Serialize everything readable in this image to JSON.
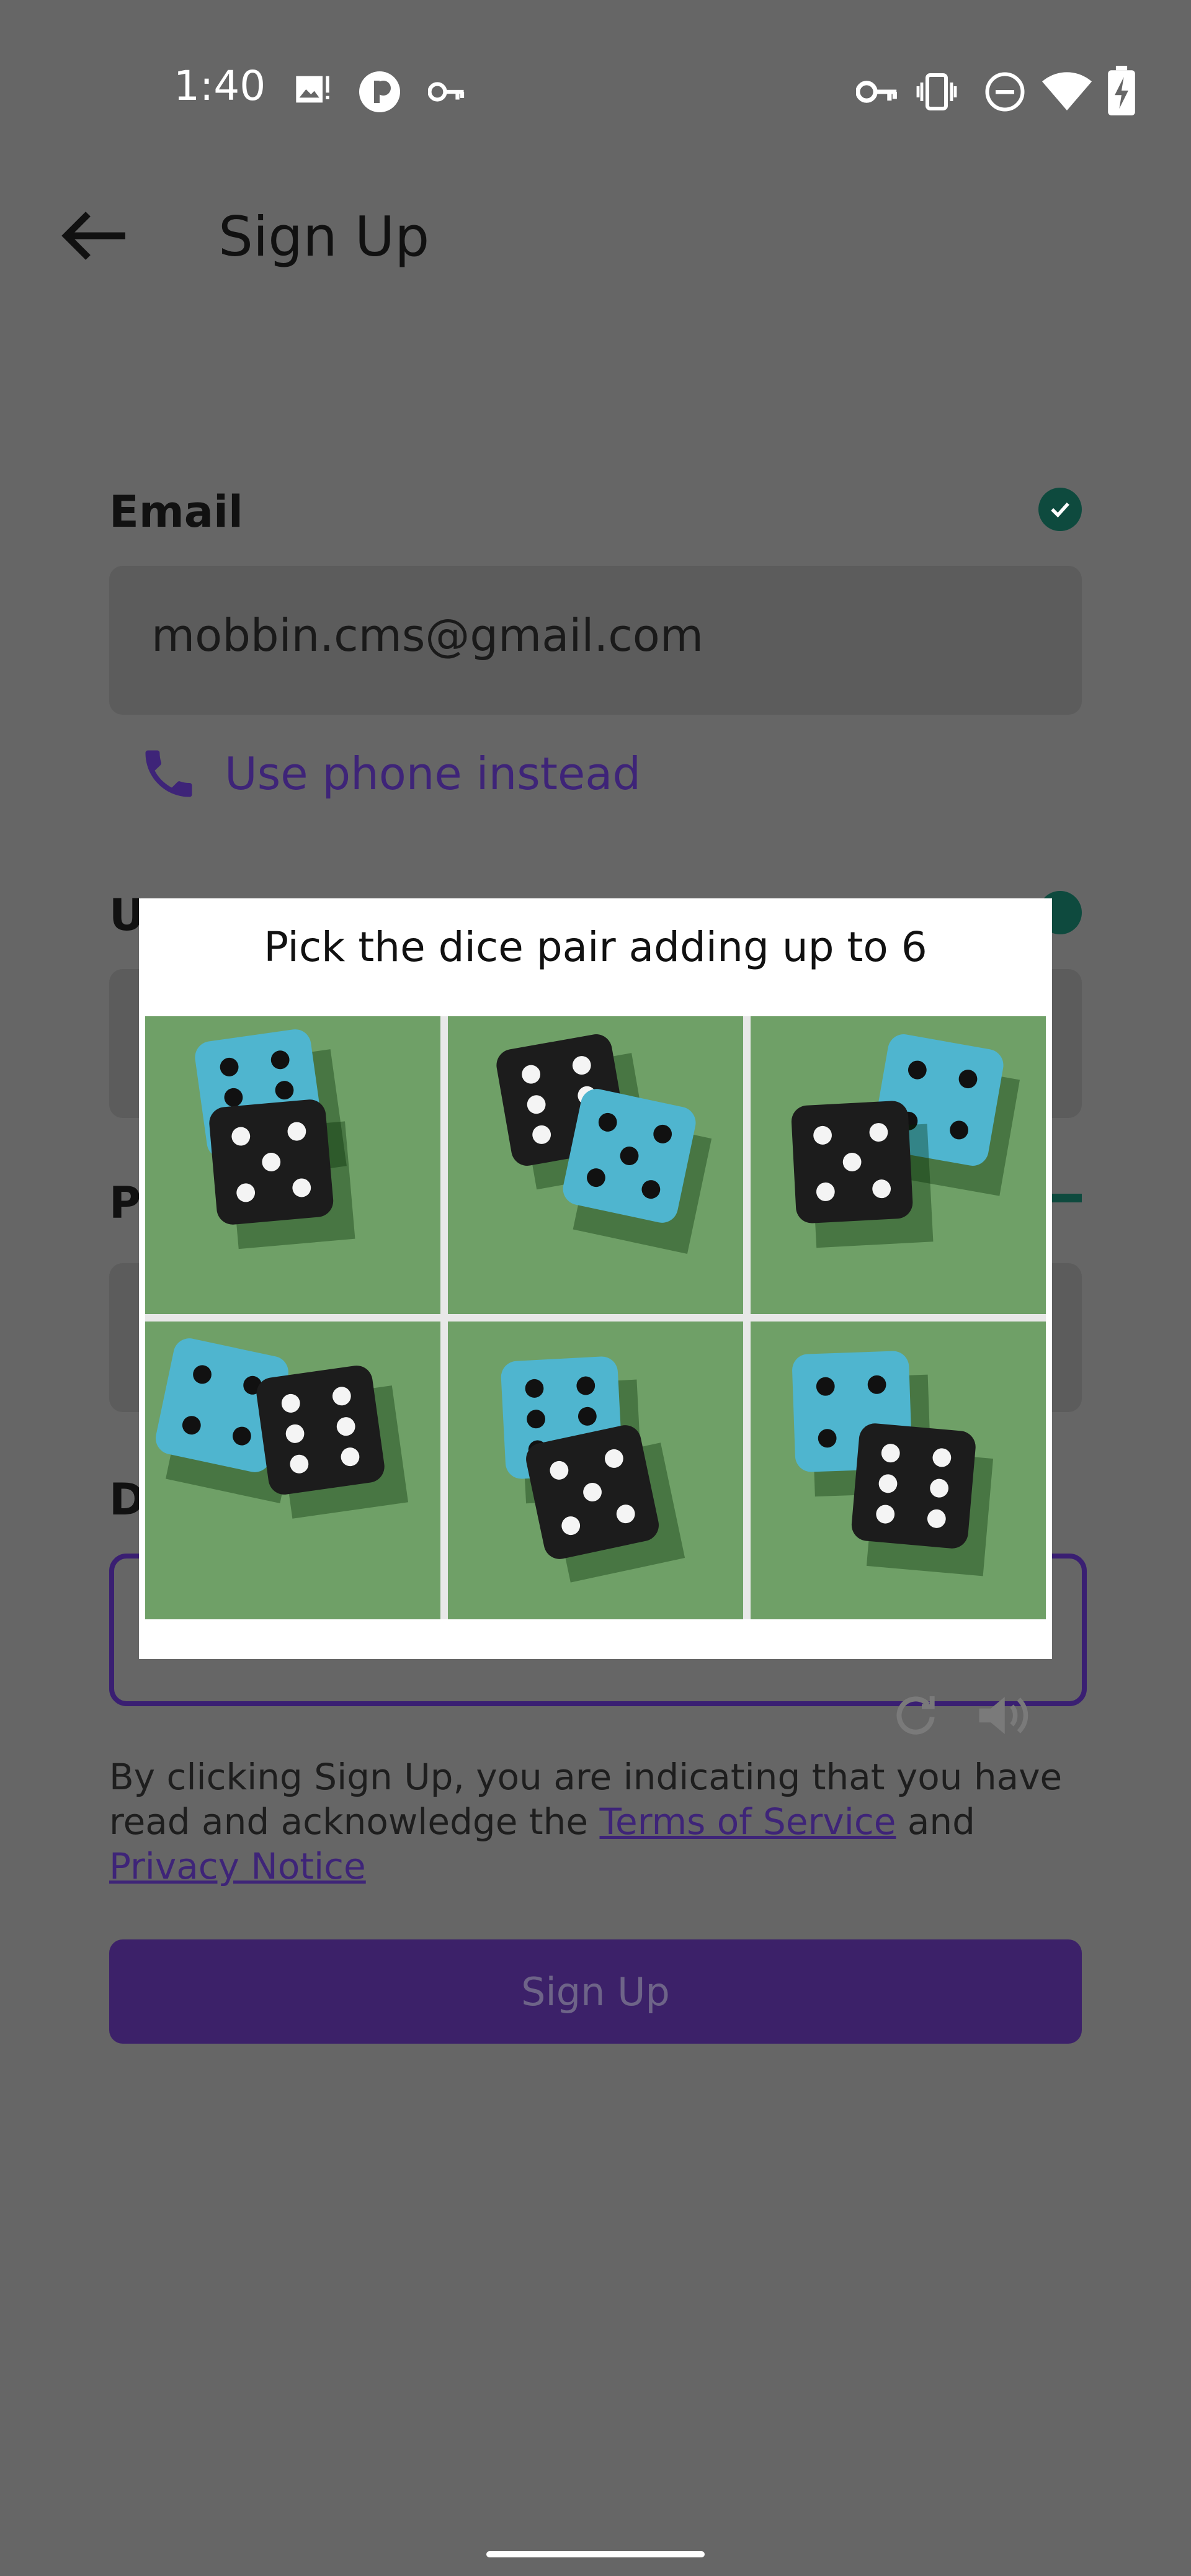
{
  "status_bar": {
    "time": "1:40"
  },
  "app_bar": {
    "title": "Sign Up"
  },
  "form": {
    "email_label": "Email",
    "email_value": "mobbin.cms@gmail.com",
    "phone_link": "Use phone instead",
    "username_label_partial": "U",
    "password_label_partial": "P",
    "dob_label_partial": "D"
  },
  "terms": {
    "text_1": "By clicking Sign Up, you are indicating that you have read and acknowledge the ",
    "tos_link": "Terms of Service",
    "text_2": " and ",
    "privacy_link": "Privacy Notice"
  },
  "signup_button": "Sign Up",
  "captcha": {
    "prompt": "Pick the dice pair adding up to 6",
    "tiles": [
      {
        "blue": 6,
        "black": 5
      },
      {
        "blue": 5,
        "black": 6
      },
      {
        "blue": 4,
        "black": 5
      },
      {
        "blue": 4,
        "black": 6
      },
      {
        "blue": 6,
        "black": 5
      },
      {
        "blue": 4,
        "black": 6
      }
    ]
  },
  "colors": {
    "overlay_bg": "#666666",
    "accent": "#3e2478",
    "check": "#0e4a3e",
    "felt": "#6fa067"
  }
}
